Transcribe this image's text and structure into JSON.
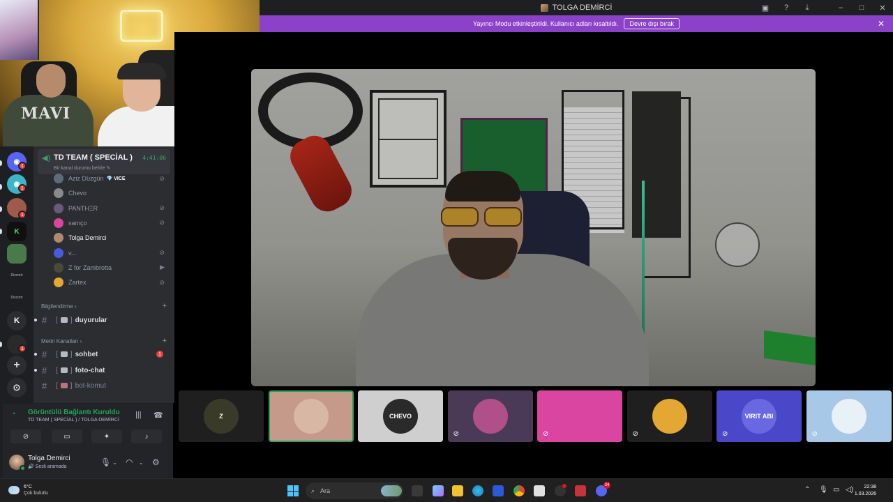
{
  "window": {
    "title": "TOLGA DEMİRCİ",
    "controls": [
      "screen-icon",
      "help-icon",
      "download-icon",
      "minimize-icon",
      "maximize-icon",
      "close-icon"
    ]
  },
  "banner": {
    "message": "Yayıncı Modu etkinleştirildi. Kullanıcı adları kısaltıldı.",
    "button": "Devre dışı bırak",
    "close": "✕"
  },
  "rail": {
    "badge": "1",
    "text_server_label": "Discord",
    "k_server": "K",
    "add_server": "+",
    "explore": "⊙"
  },
  "voice_channel": {
    "name": "TD TEAM ( SPECİAL )",
    "timer": "4:41:06",
    "status": "Bir kanal durumu belirle ✎"
  },
  "members": [
    {
      "name": "Aziz Düzgün",
      "tag": "💎 VICE",
      "muted": true,
      "color": "#5b6d7a"
    },
    {
      "name": "Chevo",
      "tag": "",
      "muted": false,
      "color": "#8a8a8a"
    },
    {
      "name": "ΡΑΝΤΗΞR",
      "tag": "",
      "muted": true,
      "color": "#6a5a7a"
    },
    {
      "name": "samço",
      "tag": "",
      "muted": true,
      "color": "#d945a0"
    },
    {
      "name": "Tolga Demirci",
      "tag": "",
      "muted": false,
      "color": "#b08a70"
    },
    {
      "name": "v...",
      "tag": "",
      "muted": true,
      "color": "#4a5ae0"
    },
    {
      "name": "Z for Zambrotta",
      "tag": "",
      "muted": false,
      "video": true,
      "color": "#4a4a3a"
    },
    {
      "name": "Zartex",
      "tag": "",
      "muted": true,
      "color": "#e3a733"
    }
  ],
  "categories": {
    "info": "Bilgilendirme",
    "text": "Metin Kanalları"
  },
  "channels": [
    {
      "name": "duyurular",
      "bracket": "[",
      "close": "]",
      "unread": true
    },
    {
      "name": "sohbet",
      "bracket": "[",
      "close": "]",
      "unread": true,
      "mentions": "1"
    },
    {
      "name": "foto-chat",
      "bracket": "[",
      "close": "]",
      "unread": true
    },
    {
      "name": "bot-komut",
      "bracket": "[",
      "close": "]",
      "unread": false
    }
  ],
  "voice_panel": {
    "state": "Görüntülü Bağlantı Kuruldu",
    "location": "TD TEAM ( SPECİAL ) / TOLGA DEMİRCİ"
  },
  "user": {
    "name": "Tolga Demirci",
    "status": "🔊 Sesli aramada"
  },
  "tiles": [
    {
      "label": "Z",
      "bg": "#1f1f1f",
      "circle": "#3a3a2a",
      "muted": false
    },
    {
      "label": "",
      "bg": "#c59a8a",
      "circle": "#d8b8a4",
      "muted": false,
      "speaking": true
    },
    {
      "label": "CHEVO",
      "bg": "#cfcfcf",
      "circle": "#2a2a2a",
      "muted": false
    },
    {
      "label": "",
      "bg": "#4a3a58",
      "circle": "#b0508a",
      "muted": true
    },
    {
      "label": "",
      "bg": "#d945a0",
      "circle": "#d945a0",
      "muted": true
    },
    {
      "label": "",
      "bg": "#1f1f1f",
      "circle": "#e3a733",
      "muted": true
    },
    {
      "label": "VIRIT ABI",
      "bg": "#4a48c8",
      "circle": "#6a68e0",
      "muted": true
    },
    {
      "label": "",
      "bg": "#a8c8e8",
      "circle": "#e8f0f8",
      "muted": true
    }
  ],
  "taskbar": {
    "weather_temp": "6°C",
    "weather_desc": "Çok bulutlu",
    "search_placeholder": "Ara",
    "time": "22:38",
    "date": "1.03.2026",
    "badge_count": "34"
  },
  "colors": {
    "accent_purple": "#8c41c9",
    "connected_green": "#23a55a",
    "mention_red": "#f23f43"
  }
}
